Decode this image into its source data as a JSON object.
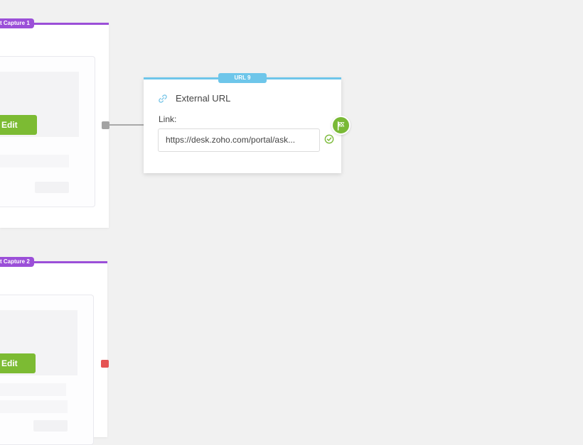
{
  "capture_nodes": [
    {
      "tag_label": "t Capture 1",
      "edit_label": "Edit"
    },
    {
      "tag_label": "t Capture 2",
      "edit_label": "Edit"
    }
  ],
  "url_node": {
    "tag_label": "URL 9",
    "title": "External URL",
    "link_label": "Link:",
    "link_value": "https://desk.zoho.com/portal/ask..."
  },
  "colors": {
    "capture_accent": "#9b4fd8",
    "url_accent": "#6ec6ea",
    "edit_green": "#7cbb33",
    "finish_green": "#79b936",
    "error_port": "#e55353"
  },
  "icons": {
    "link": "link-icon",
    "check": "check-circle-icon",
    "finish": "finish-flag-icon"
  }
}
